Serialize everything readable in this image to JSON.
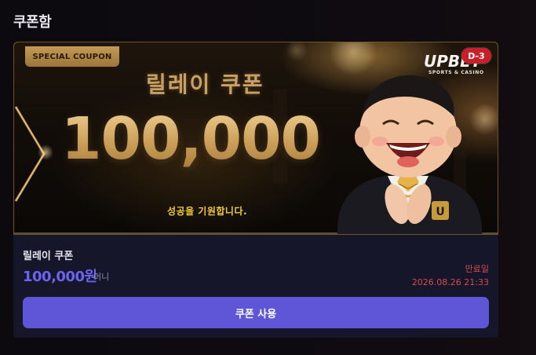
{
  "page": {
    "title": "쿠폰함"
  },
  "coupon": {
    "banner": {
      "tag": "SPECIAL COUPON",
      "headline": "릴레이 쿠폰",
      "amount": "100,000",
      "message": "성공을 기원합니다.",
      "brand_logo": "UPBET",
      "brand_sub": "SPORTS & CASINO",
      "dday_badge": "D-3"
    },
    "name": "릴레이 쿠폰",
    "value": "100,000원",
    "unit": "머니",
    "expire_label": "만료일",
    "expire_date": "2026.08.26 21:33",
    "use_button_label": "쿠폰 사용"
  },
  "colors": {
    "accent": "#5e56d6",
    "value_text": "#6c63f1",
    "expire_text": "#d8484f",
    "gold": "#c9a064",
    "badge_red": "#c8202b"
  }
}
